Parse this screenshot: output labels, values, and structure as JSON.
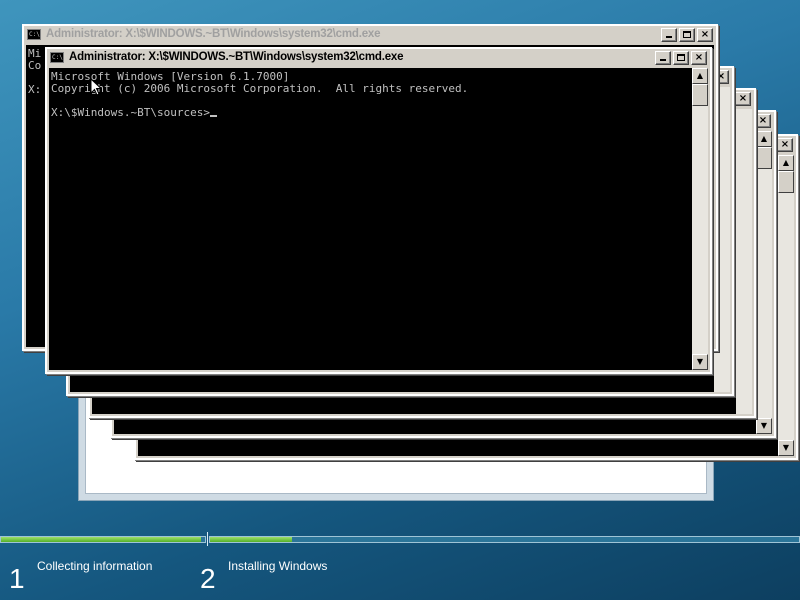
{
  "windows": {
    "title": "Administrator: X:\\$WINDOWS.~BT\\Windows\\system32\\cmd.exe",
    "icon_text": "C:\\",
    "back_console_fragment": [
      "Mi",
      "Co",
      "X:"
    ]
  },
  "console": {
    "lines": [
      "Microsoft Windows [Version 6.1.7000]",
      "Copyright (c) 2006 Microsoft Corporation.  All rights reserved.",
      "",
      "X:\\$Windows.~BT\\sources>"
    ]
  },
  "progress": {
    "step1_fill": 0.98,
    "step2_fill": 0.14,
    "fill_color": "#6cc83c"
  },
  "steps": [
    {
      "number": "1",
      "label": "Collecting information"
    },
    {
      "number": "2",
      "label": "Installing Windows"
    }
  ],
  "icons": {
    "minimize": "minimize-icon",
    "maximize": "maximize-icon",
    "close": "close-icon",
    "cmd": "cmd-icon",
    "cursor": "mouse-pointer-icon"
  }
}
